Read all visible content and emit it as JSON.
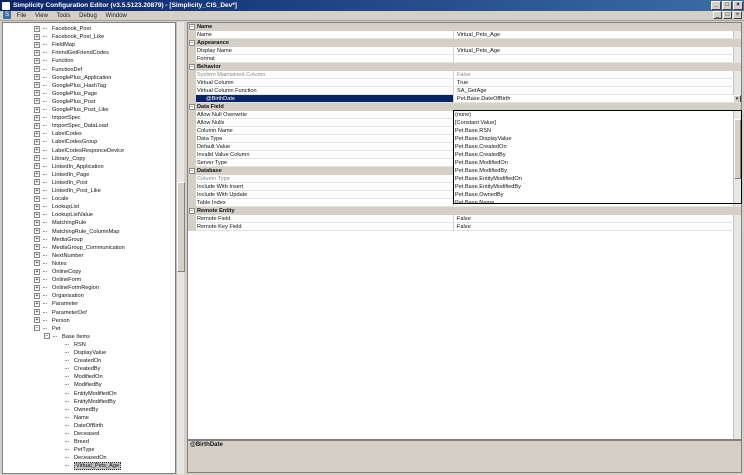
{
  "window": {
    "title": "Simplicity Configuration Editor (v3.5.5123.20879) - [Simplicity_CIS_Dev*]"
  },
  "menu": [
    "File",
    "View",
    "Tools",
    "Debug",
    "Window"
  ],
  "tree": {
    "top_items": [
      "Facebook_Post",
      "Facebook_Post_Like",
      "FieldMap",
      "FriendGetFriendCodes",
      "Function",
      "FunctionDef",
      "GooglePlus_Application",
      "GooglePlus_HashTag",
      "GooglePlus_Page",
      "GooglePlus_Post",
      "GooglePlus_Post_Like",
      "ImportSpec",
      "ImportSpec_DataLoad",
      "LabelCodes",
      "LabelCodesGroup",
      "LabelCodesResponceDevice",
      "Library_Copy",
      "LinkedIn_Application",
      "LinkedIn_Page",
      "LinkedIn_Post",
      "LinkedIn_Post_Like",
      "Locale",
      "LookupList",
      "LookupListValue",
      "MatchingRule",
      "MatchingRule_ColumnMap",
      "MediaGroup",
      "MediaGroup_Communication",
      "NextNumber",
      "Notes",
      "OnlineCopy",
      "OnlineForm",
      "OnlineFormRegion",
      "Organisation",
      "Parameter",
      "ParameterDef",
      "Person",
      "Pet"
    ],
    "group_label": "Base Items",
    "base_items": [
      "RSN",
      "DisplayValue",
      "CreatedOn",
      "CreatedBy",
      "ModifiedOn",
      "ModifiedBy",
      "EntityModifiedOn",
      "EntityModifiedBy",
      "OwnedBy",
      "Name",
      "DateOfBirth",
      "Deceased",
      "Breed",
      "PetType",
      "DeceasedOn"
    ],
    "selected_item": "Virtual_Pets_Age"
  },
  "properties": [
    {
      "kind": "cat",
      "name": "Name"
    },
    {
      "kind": "row",
      "name": "Name",
      "value": "Virtual_Pets_Age"
    },
    {
      "kind": "cat",
      "name": "Appearance"
    },
    {
      "kind": "row",
      "name": "Display Name",
      "value": "Virtual_Pets_Age"
    },
    {
      "kind": "row",
      "name": "Format",
      "value": ""
    },
    {
      "kind": "cat",
      "name": "Behavior"
    },
    {
      "kind": "dim",
      "name": "System Maintained Column",
      "value": "False"
    },
    {
      "kind": "row",
      "name": "Virtual Column",
      "value": "True"
    },
    {
      "kind": "row",
      "name": "Virtual Column Function",
      "value": "SA_GetAge"
    },
    {
      "kind": "selrow",
      "name": "@BirthDate",
      "value": "Pet.Base.DateOfBirth"
    },
    {
      "kind": "cat",
      "name": "Data Field"
    },
    {
      "kind": "row",
      "name": "Allow Null Overwrite",
      "value": ""
    },
    {
      "kind": "row",
      "name": "Allow Nulls",
      "value": ""
    },
    {
      "kind": "row",
      "name": "Column Name",
      "value": ""
    },
    {
      "kind": "row",
      "name": "Data Type",
      "value": ""
    },
    {
      "kind": "row",
      "name": "Default Value",
      "value": ""
    },
    {
      "kind": "row",
      "name": "Invalid Value Column",
      "value": ""
    },
    {
      "kind": "row",
      "name": "Server Type",
      "value": ""
    },
    {
      "kind": "cat",
      "name": "Database"
    },
    {
      "kind": "dim",
      "name": "Column Type",
      "value": ""
    },
    {
      "kind": "row",
      "name": "Include With Insert",
      "value": ""
    },
    {
      "kind": "row",
      "name": "Include With Update",
      "value": ""
    },
    {
      "kind": "row",
      "name": "Table Index",
      "value": ""
    },
    {
      "kind": "cat",
      "name": "Remote Entity"
    },
    {
      "kind": "row",
      "name": "Remote Field",
      "value": "False"
    },
    {
      "kind": "row",
      "name": "Remote Key Field",
      "value": "False"
    }
  ],
  "dropdown": {
    "items": [
      "(none)",
      "[Constant Value]",
      "Pet.Base.RSN",
      "Pet.Base.DisplayValue",
      "Pet.Base.CreatedOn",
      "Pet.Base.CreatedBy",
      "Pet.Base.ModifiedOn",
      "Pet.Base.ModifiedBy",
      "Pet.Base.EntityModifiedOn",
      "Pet.Base.EntityModifiedBy",
      "Pet.Base.OwnedBy",
      "Pet.Base.Name",
      "Pet.Base.DateOfBirth"
    ],
    "selected": "Pet.Base.DateOfBirth"
  },
  "help": {
    "title": "@BirthDate"
  }
}
